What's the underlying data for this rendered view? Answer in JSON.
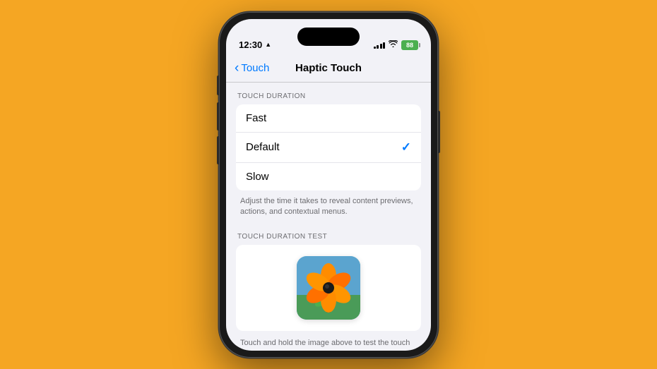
{
  "background": {
    "color": "#F5A623"
  },
  "phone": {
    "status_bar": {
      "time": "12:30",
      "location_icon": "▲",
      "battery_label": "88",
      "signal_bars": [
        3,
        5,
        7,
        9,
        11
      ],
      "wifi": "wifi"
    },
    "nav": {
      "back_label": "Touch",
      "title": "Haptic Touch"
    },
    "content": {
      "section1_header": "TOUCH DURATION",
      "list_items": [
        {
          "label": "Fast",
          "selected": false
        },
        {
          "label": "Default",
          "selected": true
        },
        {
          "label": "Slow",
          "selected": false
        }
      ],
      "description": "Adjust the time it takes to reveal content previews, actions, and contextual menus.",
      "section2_header": "TOUCH DURATION TEST",
      "test_bottom_text": "Touch and hold the image above to test the touch duration."
    }
  }
}
